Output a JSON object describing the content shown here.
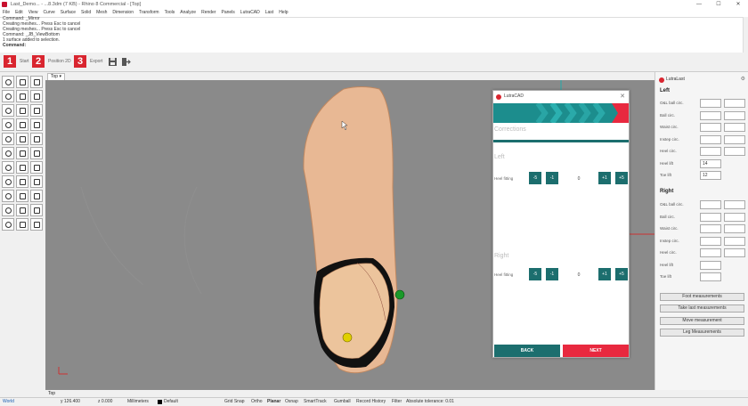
{
  "window": {
    "title": "Last_Demo... - ...8.3dm (7 KB) - Rhino 8 Commercial - [Top]",
    "controls": [
      "—",
      "☐",
      "✕"
    ]
  },
  "menu": [
    "File",
    "Edit",
    "View",
    "Curve",
    "Surface",
    "Solid",
    "Mesh",
    "Dimension",
    "Transform",
    "Tools",
    "Analyze",
    "Render",
    "Panels",
    "LutraCAD",
    "Last",
    "Help"
  ],
  "command_history": [
    "Command: _Mirror",
    "Creating meshes... Press Esc to cancel",
    "Creating meshes... Press Esc to cancel",
    "Command: _JB_ViewBottom",
    "1 surface added to selection."
  ],
  "command_prompt": "Command:",
  "steps": [
    {
      "num": "1",
      "label": "Start"
    },
    {
      "num": "2",
      "label": "Position 2D"
    },
    {
      "num": "3",
      "label": "Export"
    }
  ],
  "viewport": {
    "tab": "Top",
    "bottom_tab": "Top"
  },
  "dialog": {
    "title": "LutraCAD",
    "heading": "Corrections",
    "left": {
      "section": "Left",
      "label": "Heel fitting",
      "buttons": [
        "-5",
        "-1",
        "+1",
        "+5"
      ],
      "value": "0"
    },
    "right": {
      "section": "Right",
      "label": "Heel fitting",
      "buttons": [
        "-5",
        "-1",
        "+1",
        "+5"
      ],
      "value": "0"
    },
    "back": "BACK",
    "next": "NEXT"
  },
  "panel": {
    "title": "LutraLast",
    "left_heading": "Left",
    "left_rows": [
      {
        "label": "O&L ball circ.",
        "a": "",
        "b": ""
      },
      {
        "label": "Ball circ.",
        "a": "",
        "b": ""
      },
      {
        "label": "Waist circ.",
        "a": "",
        "b": ""
      },
      {
        "label": "Instep circ.",
        "a": "",
        "b": ""
      },
      {
        "label": "Heel circ.",
        "a": "",
        "b": ""
      },
      {
        "label": "Heel lift",
        "a": "14"
      },
      {
        "label": "Toe lift",
        "a": "12"
      }
    ],
    "right_heading": "Right",
    "right_rows": [
      {
        "label": "O&L ball circ.",
        "a": "",
        "b": ""
      },
      {
        "label": "Ball circ.",
        "a": "",
        "b": ""
      },
      {
        "label": "Waist circ.",
        "a": "",
        "b": ""
      },
      {
        "label": "Instep circ.",
        "a": "",
        "b": ""
      },
      {
        "label": "Heel circ.",
        "a": "",
        "b": ""
      },
      {
        "label": "Heel lift"
      },
      {
        "label": "Toe lift"
      }
    ],
    "buttons": [
      "Foot measurements",
      "Take last measurements",
      "Move measurement",
      "Leg Measurements"
    ]
  },
  "status": {
    "cplane": "World",
    "y": "y 126.400",
    "z": "z 0.000",
    "units": "Millimeters",
    "layer": "Default",
    "toggles": [
      "Grid Snap",
      "Ortho",
      "Planar",
      "Osnap",
      "SmartTrack",
      "Gumball",
      "Record History",
      "Filter"
    ],
    "tolerance": "Absolute tolerance: 0.01"
  },
  "colors": {
    "accent": "#d9252f",
    "teal": "#1c6e6e",
    "banner": "#1c8d8d",
    "next": "#e8293f",
    "last": "#e8b894"
  }
}
